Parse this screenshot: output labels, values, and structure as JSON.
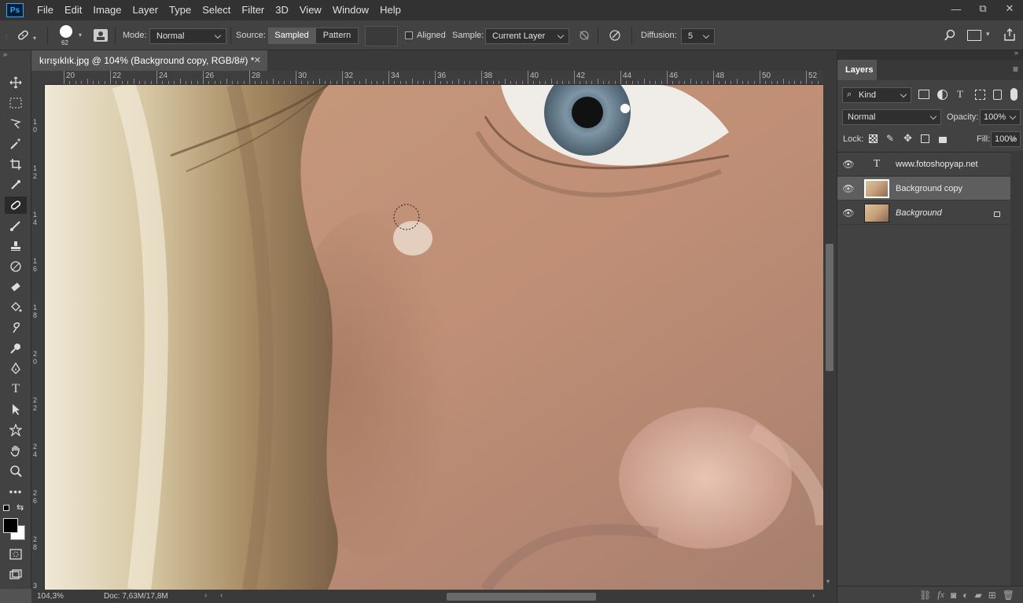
{
  "app": {
    "logo": "Ps"
  },
  "menu": [
    "File",
    "Edit",
    "Image",
    "Layer",
    "Type",
    "Select",
    "Filter",
    "3D",
    "View",
    "Window",
    "Help"
  ],
  "window_controls": {
    "minimize": "—",
    "restore": "⧉",
    "close": "✕"
  },
  "options": {
    "brush_size": "62",
    "mode_label": "Mode:",
    "mode_value": "Normal",
    "source_label": "Source:",
    "source_sampled": "Sampled",
    "source_pattern": "Pattern",
    "aligned_label": "Aligned",
    "sample_label": "Sample:",
    "sample_value": "Current Layer",
    "diffusion_label": "Diffusion:",
    "diffusion_value": "5"
  },
  "document": {
    "tab_title": "kırışıklık.jpg @ 104% (Background copy, RGB/8#) *",
    "close": "✕"
  },
  "ruler": {
    "top_labels": [
      "20",
      "22",
      "24",
      "26",
      "28",
      "30",
      "32",
      "34",
      "36",
      "38",
      "40",
      "42",
      "44",
      "46",
      "48",
      "50",
      "52"
    ],
    "left_labels": [
      "10",
      "12",
      "14",
      "16",
      "18",
      "20",
      "22",
      "24",
      "26",
      "28",
      "3"
    ]
  },
  "status": {
    "zoom": "104,3%",
    "doc": "Doc: 7,63M/17,8M"
  },
  "layers_panel": {
    "tab": "Layers",
    "filter_value": "Kind",
    "blend_value": "Normal",
    "opacity_label": "Opacity:",
    "opacity_value": "100%",
    "lock_label": "Lock:",
    "fill_label": "Fill:",
    "fill_value": "100%",
    "layers": [
      {
        "name": "www.fotoshopyap.net",
        "type": "text"
      },
      {
        "name": "Background copy",
        "type": "image",
        "selected": true
      },
      {
        "name": "Background",
        "type": "image",
        "locked": true
      }
    ]
  },
  "colors": {
    "foreground": "#000000",
    "background": "#ffffff"
  }
}
